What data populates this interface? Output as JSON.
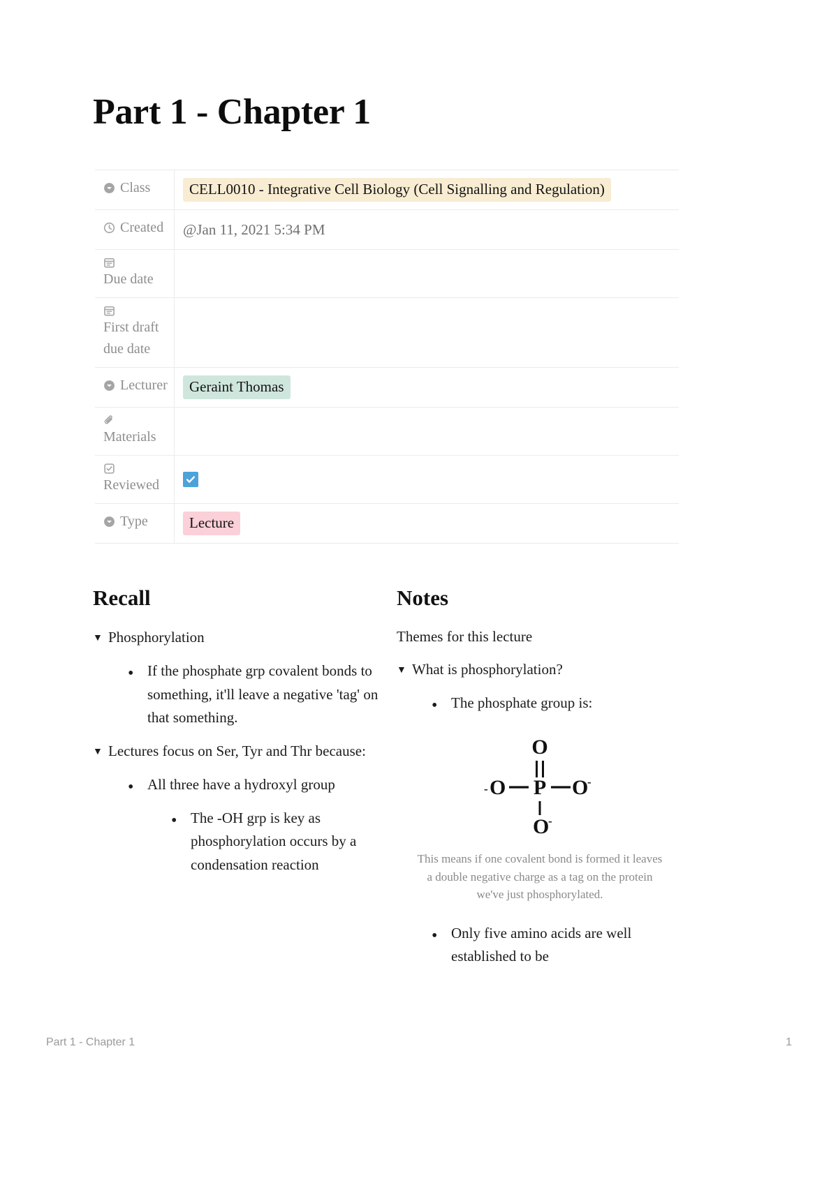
{
  "document": {
    "title": "Part 1 - Chapter 1"
  },
  "properties": [
    {
      "icon": "select-chevron-circle-icon",
      "label": "Class",
      "value": "CELL0010 - Integrative Cell Biology (Cell Signalling and Regulation)",
      "value_type": "tag",
      "tag_color": "#f8ecd2"
    },
    {
      "icon": "clock-icon",
      "label": "Created",
      "value": "@Jan 11, 2021 5:34 PM",
      "value_type": "text"
    },
    {
      "icon": "calendar-note-icon",
      "label": "Due date",
      "value": "",
      "value_type": "empty"
    },
    {
      "icon": "calendar-note-icon",
      "label": "First draft due date",
      "value": "",
      "value_type": "empty"
    },
    {
      "icon": "select-chevron-circle-icon",
      "label": "Lecturer",
      "value": "Geraint Thomas",
      "value_type": "tag",
      "tag_color": "#cfe6dd"
    },
    {
      "icon": "paperclip-icon",
      "label": "Materials",
      "value": "",
      "value_type": "empty"
    },
    {
      "icon": "checkbox-icon",
      "label": "Reviewed",
      "value": "checked",
      "value_type": "checkbox",
      "checkbox_color": "#4da2d9"
    },
    {
      "icon": "select-chevron-circle-icon",
      "label": "Type",
      "value": "Lecture",
      "value_type": "tag",
      "tag_color": "#fbd0d8"
    }
  ],
  "recall": {
    "heading": "Recall",
    "items": [
      {
        "level": 1,
        "marker": "toggle",
        "text": "Phosphorylation"
      },
      {
        "level": 2,
        "marker": "bullet",
        "text": "If the phosphate grp covalent bonds to something, it'll leave a negative 'tag' on that something."
      },
      {
        "level": 1,
        "marker": "toggle",
        "text": "Lectures focus on Ser, Tyr and Thr because:"
      },
      {
        "level": 2,
        "marker": "bullet",
        "text": "All three have a hydroxyl group"
      },
      {
        "level": 3,
        "marker": "bullet",
        "text": "The -OH grp is key as phosphorylation occurs by a condensation reaction"
      }
    ]
  },
  "notes": {
    "heading": "Notes",
    "lead": "Themes for this lecture",
    "items_before_figure": [
      {
        "level": 1,
        "marker": "toggle",
        "text": "What is phosphorylation?"
      },
      {
        "level": 2,
        "marker": "bullet",
        "text": "The phosphate group is:"
      }
    ],
    "figure": {
      "name": "phosphate-group-structure",
      "top_atom": "O",
      "top_bond": "double",
      "left_atom": "⁻O",
      "left_label": "-O",
      "center_atom": "P",
      "right_atom": "O⁻",
      "right_label": "O-",
      "bottom_atom": "O⁻",
      "bottom_label": "O-",
      "bottom_bond": "single"
    },
    "caption": "This means if one covalent bond is formed it leaves a double negative charge as a tag on the protein we've just phosphorylated.",
    "items_after_figure": [
      {
        "level": 2,
        "marker": "bullet",
        "text": "Only five amino acids are well established to be"
      }
    ]
  },
  "footer": {
    "left": "Part 1 - Chapter 1",
    "right": "1"
  }
}
